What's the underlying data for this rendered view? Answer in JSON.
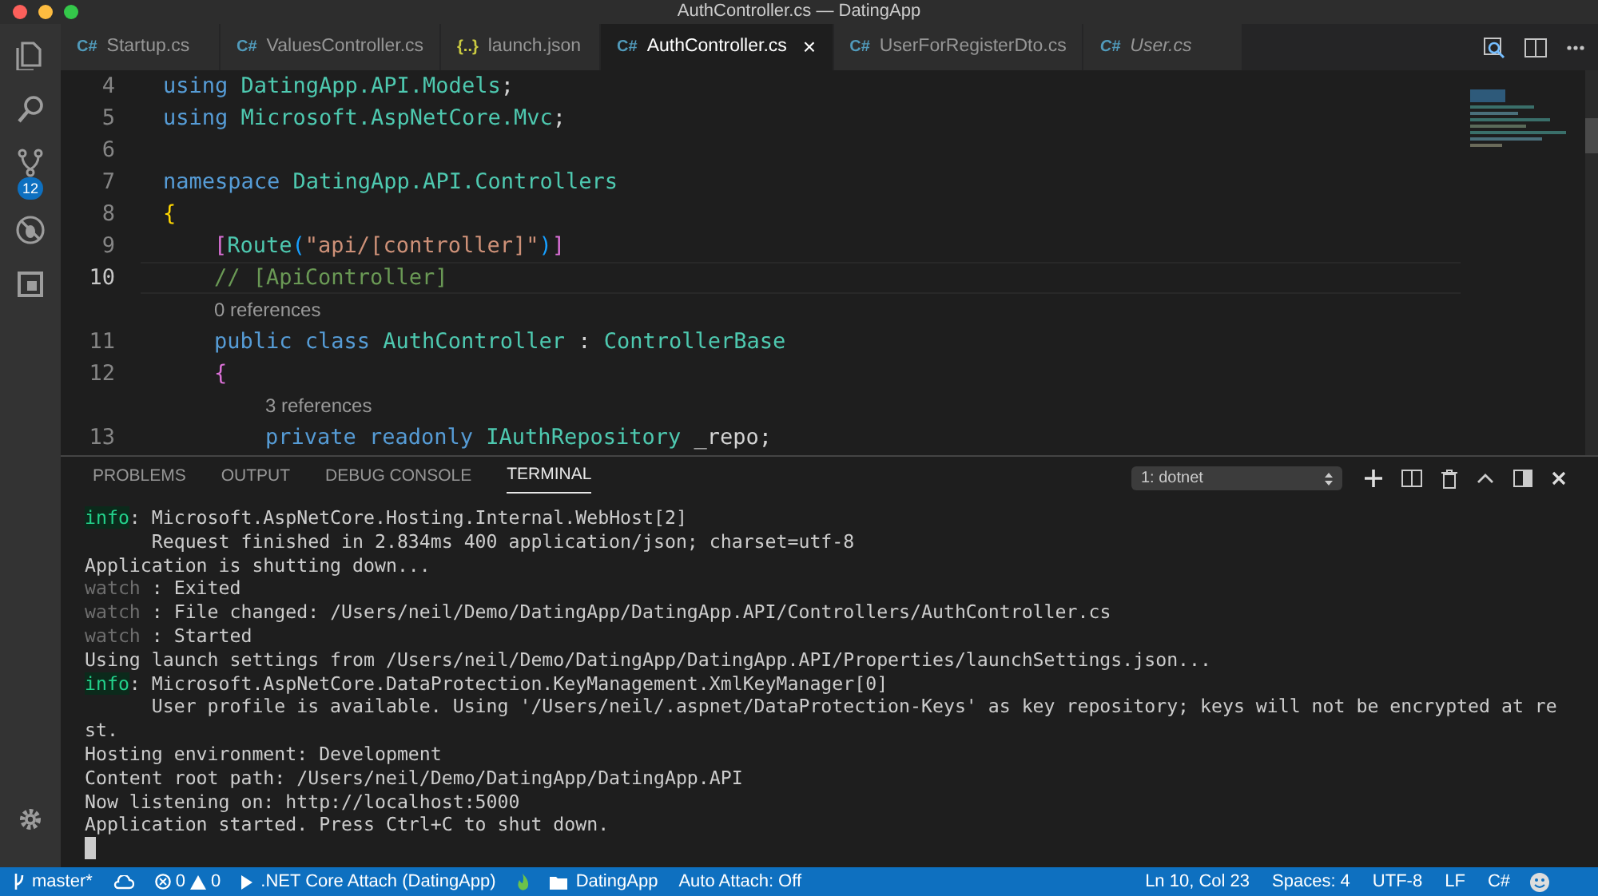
{
  "window": {
    "title": "AuthController.cs — DatingApp"
  },
  "activity_bar": {
    "items": [
      {
        "kind": "files",
        "selected": false
      },
      {
        "kind": "search",
        "selected": false
      },
      {
        "kind": "git",
        "selected": false,
        "badge": "12"
      },
      {
        "kind": "debug",
        "selected": false
      },
      {
        "kind": "extensions",
        "selected": false
      }
    ]
  },
  "tabs": [
    {
      "label": "Startup.cs",
      "icon": "C#",
      "kind": "cs",
      "selected": false,
      "preview": false
    },
    {
      "label": "ValuesController.cs",
      "icon": "C#",
      "kind": "cs",
      "selected": false,
      "preview": false
    },
    {
      "label": "launch.json",
      "icon": "{..}",
      "kind": "json",
      "selected": false,
      "preview": false
    },
    {
      "label": "AuthController.cs",
      "icon": "C#",
      "kind": "cs",
      "selected": true,
      "preview": false,
      "close": "×"
    },
    {
      "label": "UserForRegisterDto.cs",
      "icon": "C#",
      "kind": "cs",
      "selected": false,
      "preview": false
    },
    {
      "label": "User.cs",
      "icon": "C#",
      "kind": "cs",
      "selected": false,
      "preview": true
    }
  ],
  "editor": {
    "lines": [
      {
        "kind": "code",
        "number": "4",
        "current": false,
        "tokens": [
          {
            "kind": "keyword",
            "t": "using"
          },
          {
            "kind": "type",
            "t": " DatingApp.API.Models"
          },
          {
            "kind": "plain",
            "t": ";"
          }
        ]
      },
      {
        "kind": "code",
        "number": "5",
        "current": false,
        "tokens": [
          {
            "kind": "keyword",
            "t": "using"
          },
          {
            "kind": "type",
            "t": " Microsoft.AspNetCore.Mvc"
          },
          {
            "kind": "plain",
            "t": ";"
          }
        ]
      },
      {
        "kind": "code",
        "number": "6",
        "current": false
      },
      {
        "kind": "code",
        "number": "7",
        "current": false,
        "tokens": [
          {
            "kind": "keyword",
            "t": "namespace"
          },
          {
            "kind": "type",
            "t": " DatingApp.API.Controllers"
          }
        ]
      },
      {
        "kind": "code",
        "number": "8",
        "current": false,
        "tokens": [
          {
            "kind": "brace1",
            "t": "{"
          }
        ],
        "children": [
          {
            "kind": "code",
            "number": "9",
            "current": false,
            "tokens": [
              {
                "kind": "brace2",
                "t": "["
              },
              {
                "kind": "type",
                "t": "Route"
              },
              {
                "kind": "brace3",
                "t": "("
              },
              {
                "kind": "string",
                "t": "\"api/[controller]\""
              },
              {
                "kind": "brace3",
                "t": ")"
              },
              {
                "kind": "brace2",
                "t": "]"
              }
            ]
          },
          {
            "kind": "code",
            "number": "10",
            "current": true,
            "tokens": [
              {
                "kind": "comment",
                "t": "// [ApiController]"
              }
            ]
          },
          {
            "kind": "lens",
            "text": "0 references"
          },
          {
            "kind": "code",
            "number": "11",
            "current": false,
            "tokens": [
              {
                "kind": "keyword",
                "t": "public class"
              },
              {
                "kind": "type",
                "t": " AuthController"
              },
              {
                "kind": "plain",
                "t": " : "
              },
              {
                "kind": "type",
                "t": "ControllerBase"
              }
            ]
          },
          {
            "kind": "code",
            "number": "12",
            "current": false,
            "tokens": [
              {
                "kind": "brace2",
                "t": "{"
              }
            ],
            "children": [
              {
                "kind": "lens",
                "text": "3 references"
              },
              {
                "kind": "code",
                "number": "13",
                "current": false,
                "tokens": [
                  {
                    "kind": "keyword",
                    "t": "private readonly"
                  },
                  {
                    "kind": "type",
                    "t": " IAuthRepository"
                  },
                  {
                    "kind": "plain",
                    "t": " _repo;"
                  }
                ]
              }
            ]
          }
        ]
      }
    ]
  },
  "panel": {
    "tabs": [
      {
        "label": "PROBLEMS",
        "selected": false
      },
      {
        "label": "OUTPUT",
        "selected": false
      },
      {
        "label": "DEBUG CONSOLE",
        "selected": false
      },
      {
        "label": "TERMINAL",
        "selected": true
      }
    ],
    "terminal_select": "1: dotnet",
    "terminal_lines": [
      {
        "prefix": "info",
        "text": ": Microsoft.AspNetCore.Hosting.Internal.WebHost[2]"
      },
      {
        "text": "      Request finished in 2.834ms 400 application/json; charset=utf-8"
      },
      {
        "text": "Application is shutting down..."
      },
      {
        "prefix": "watch",
        "text": " : Exited"
      },
      {
        "prefix": "watch",
        "text": " : File changed: /Users/neil/Demo/DatingApp/DatingApp.API/Controllers/AuthController.cs"
      },
      {
        "prefix": "watch",
        "text": " : Started"
      },
      {
        "text": "Using launch settings from /Users/neil/Demo/DatingApp/DatingApp.API/Properties/launchSettings.json..."
      },
      {
        "prefix": "info",
        "text": ": Microsoft.AspNetCore.DataProtection.KeyManagement.XmlKeyManager[0]"
      },
      {
        "text": "      User profile is available. Using '/Users/neil/.aspnet/DataProtection-Keys' as key repository; keys will not be encrypted at re"
      },
      {
        "text": "st."
      },
      {
        "text": "Hosting environment: Development"
      },
      {
        "text": "Content root path: /Users/neil/Demo/DatingApp/DatingApp.API"
      },
      {
        "text": "Now listening on: http://localhost:5000"
      },
      {
        "text": "Application started. Press Ctrl+C to shut down."
      }
    ]
  },
  "status_bar": {
    "left": [
      {
        "kind": "branch",
        "text": "master*"
      },
      {
        "kind": "sync"
      },
      {
        "kind": "problems",
        "errors": "0",
        "warnings": "0"
      },
      {
        "kind": "debug",
        "text": ".NET Core Attach (DatingApp)"
      },
      {
        "kind": "flame"
      },
      {
        "kind": "folder",
        "text": "DatingApp"
      },
      {
        "kind": "plain",
        "text": "Auto Attach: Off"
      }
    ],
    "right": [
      "Ln 10, Col 23",
      "Spaces: 4",
      "UTF-8",
      "LF",
      "C#"
    ]
  }
}
